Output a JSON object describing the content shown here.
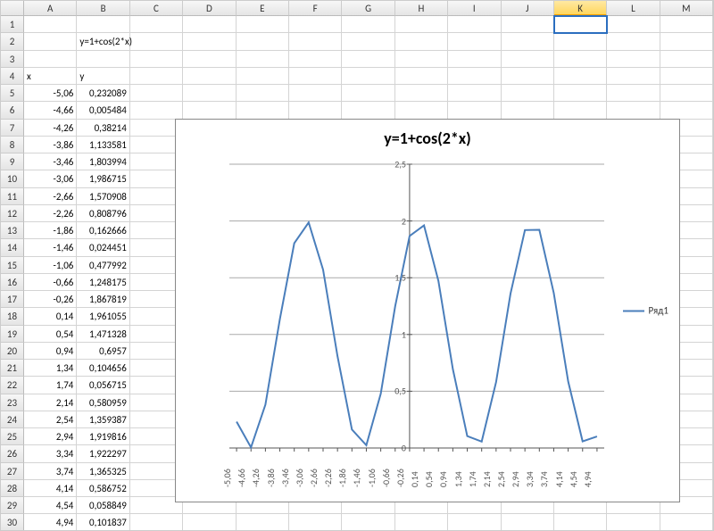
{
  "columns": [
    "A",
    "B",
    "C",
    "D",
    "E",
    "F",
    "G",
    "H",
    "I",
    "J",
    "K",
    "L",
    "M"
  ],
  "selected_col": "K",
  "selected_cell": "K1",
  "formula_text": "y=1+cos(2*x)",
  "headers": {
    "x": "x",
    "y": "y"
  },
  "rows": [
    {
      "n": 1
    },
    {
      "n": 2,
      "B": "y=1+cos(2*x)"
    },
    {
      "n": 3
    },
    {
      "n": 4,
      "A": "x",
      "B": "y"
    },
    {
      "n": 5,
      "A": "-5,06",
      "B": "0,232089"
    },
    {
      "n": 6,
      "A": "-4,66",
      "B": "0,005484"
    },
    {
      "n": 7,
      "A": "-4,26",
      "B": "0,38214"
    },
    {
      "n": 8,
      "A": "-3,86",
      "B": "1,133581"
    },
    {
      "n": 9,
      "A": "-3,46",
      "B": "1,803994"
    },
    {
      "n": 10,
      "A": "-3,06",
      "B": "1,986715"
    },
    {
      "n": 11,
      "A": "-2,66",
      "B": "1,570908"
    },
    {
      "n": 12,
      "A": "-2,26",
      "B": "0,808796"
    },
    {
      "n": 13,
      "A": "-1,86",
      "B": "0,162666"
    },
    {
      "n": 14,
      "A": "-1,46",
      "B": "0,024451"
    },
    {
      "n": 15,
      "A": "-1,06",
      "B": "0,477992"
    },
    {
      "n": 16,
      "A": "-0,66",
      "B": "1,248175"
    },
    {
      "n": 17,
      "A": "-0,26",
      "B": "1,867819"
    },
    {
      "n": 18,
      "A": "0,14",
      "B": "1,961055"
    },
    {
      "n": 19,
      "A": "0,54",
      "B": "1,471328"
    },
    {
      "n": 20,
      "A": "0,94",
      "B": "0,6957"
    },
    {
      "n": 21,
      "A": "1,34",
      "B": "0,104656"
    },
    {
      "n": 22,
      "A": "1,74",
      "B": "0,056715"
    },
    {
      "n": 23,
      "A": "2,14",
      "B": "0,580959"
    },
    {
      "n": 24,
      "A": "2,54",
      "B": "1,359387"
    },
    {
      "n": 25,
      "A": "2,94",
      "B": "1,919816"
    },
    {
      "n": 26,
      "A": "3,34",
      "B": "1,922297"
    },
    {
      "n": 27,
      "A": "3,74",
      "B": "1,365325"
    },
    {
      "n": 28,
      "A": "4,14",
      "B": "0,586752"
    },
    {
      "n": 29,
      "A": "4,54",
      "B": "0,058849"
    },
    {
      "n": 30,
      "A": "4,94",
      "B": "0,101837"
    }
  ],
  "chart_data": {
    "type": "line",
    "title": "y=1+cos(2*x)",
    "ylabel": "",
    "xlabel": "",
    "ylim": [
      0,
      2.5
    ],
    "y_ticks": [
      0,
      0.5,
      1,
      1.5,
      2,
      2.5
    ],
    "y_tick_labels": [
      "0",
      "0,5",
      "1",
      "1,5",
      "2",
      "2,5"
    ],
    "categories": [
      "-5,06",
      "-4,66",
      "-4,26",
      "-3,86",
      "-3,46",
      "-3,06",
      "-2,66",
      "-2,26",
      "-1,86",
      "-1,46",
      "-1,06",
      "-0,66",
      "-0,26",
      "0,14",
      "0,54",
      "0,94",
      "1,34",
      "1,74",
      "2,14",
      "2,54",
      "2,94",
      "3,34",
      "3,74",
      "4,14",
      "4,54",
      "4,94"
    ],
    "series": [
      {
        "name": "Ряд1",
        "values": [
          0.232089,
          0.005484,
          0.38214,
          1.133581,
          1.803994,
          1.986715,
          1.570908,
          0.808796,
          0.162666,
          0.024451,
          0.477992,
          1.248175,
          1.867819,
          1.961055,
          1.471328,
          0.6957,
          0.104656,
          0.056715,
          0.580959,
          1.359387,
          1.919816,
          1.922297,
          1.365325,
          0.586752,
          0.058849,
          0.101837
        ]
      }
    ],
    "y_axis_category_index": 12
  },
  "legend_label": "Ряд1"
}
